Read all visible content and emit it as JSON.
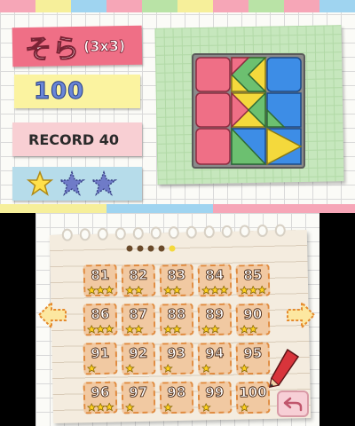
{
  "top": {
    "title": "そら",
    "title_sub": "(3x3)",
    "moves": "100",
    "record": "RECORD 40",
    "stars": {
      "earned": 1,
      "total": 3
    },
    "puzzle": {
      "grid": [
        [
          "pink",
          "pink-green-left",
          "blue"
        ],
        [
          "pink",
          "yellow-green",
          "blue-green"
        ],
        [
          "pink",
          "blue-green",
          "yellow-right"
        ]
      ]
    }
  },
  "bottom": {
    "levels": [
      {
        "num": "81",
        "stars": 3
      },
      {
        "num": "82",
        "stars": 2
      },
      {
        "num": "83",
        "stars": 2
      },
      {
        "num": "84",
        "stars": 3
      },
      {
        "num": "85",
        "stars": 3
      },
      {
        "num": "86",
        "stars": 3
      },
      {
        "num": "87",
        "stars": 2
      },
      {
        "num": "88",
        "stars": 2
      },
      {
        "num": "89",
        "stars": 2
      },
      {
        "num": "90",
        "stars": 2
      },
      {
        "num": "91",
        "stars": 1
      },
      {
        "num": "92",
        "stars": 1
      },
      {
        "num": "93",
        "stars": 1
      },
      {
        "num": "94",
        "stars": 1
      },
      {
        "num": "95",
        "stars": 1
      },
      {
        "num": "96",
        "stars": 3
      },
      {
        "num": "97",
        "stars": 1
      },
      {
        "num": "98",
        "stars": 1
      },
      {
        "num": "99",
        "stars": 1
      },
      {
        "num": "100",
        "stars": 1
      }
    ],
    "page": {
      "current": 5,
      "total": 5
    }
  },
  "colors": {
    "pink": "#ef6f86",
    "blue": "#3d8de6",
    "green": "#6cc070",
    "yellow": "#f4d93c",
    "star_gold": "#ffe04a",
    "star_empty": "#6f7bc8"
  }
}
